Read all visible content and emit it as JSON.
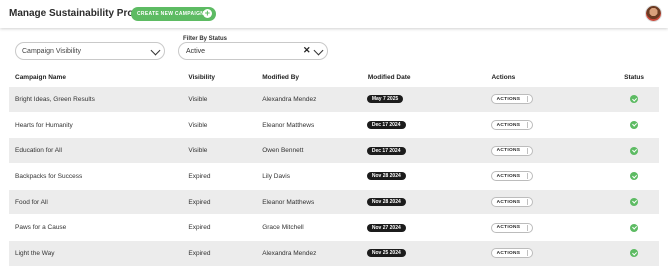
{
  "header": {
    "title": "Manage Sustainability Projects",
    "create_button": "CREATE NEW CAMPAIGN",
    "plus_icon": "plus-icon",
    "avatar_icon": "user-avatar"
  },
  "filters": {
    "visibility_value": "Campaign Visibility",
    "status_label": "Filter By Status",
    "status_value": "Active"
  },
  "table": {
    "columns": [
      "Campaign Name",
      "Visibility",
      "Modified By",
      "Modified Date",
      "Actions",
      "Status"
    ],
    "action_label": "ACTIONS",
    "status_icon": "check-circle-icon",
    "status_color": "#5dbb63",
    "rows": [
      {
        "name": "Bright Ideas, Green Results",
        "visibility": "Visible",
        "modified_by": "Alexandra Mendez",
        "date": "May 7 2025"
      },
      {
        "name": "Hearts for Humanity",
        "visibility": "Visible",
        "modified_by": "Eleanor Matthews",
        "date": "Dec 17 2024"
      },
      {
        "name": "Education for All",
        "visibility": "Visible",
        "modified_by": "Owen Bennett",
        "date": "Dec 17 2024"
      },
      {
        "name": "Backpacks for Success",
        "visibility": "Expired",
        "modified_by": "Lily Davis",
        "date": "Nov 28 2024"
      },
      {
        "name": "Food for All",
        "visibility": "Expired",
        "modified_by": "Eleanor Matthews",
        "date": "Nov 28 2024"
      },
      {
        "name": "Paws for a Cause",
        "visibility": "Expired",
        "modified_by": "Grace Mitchell",
        "date": "Nov 27 2024"
      },
      {
        "name": "Light the Way",
        "visibility": "Expired",
        "modified_by": "Alexandra Mendez",
        "date": "Nov 25 2024"
      }
    ]
  }
}
